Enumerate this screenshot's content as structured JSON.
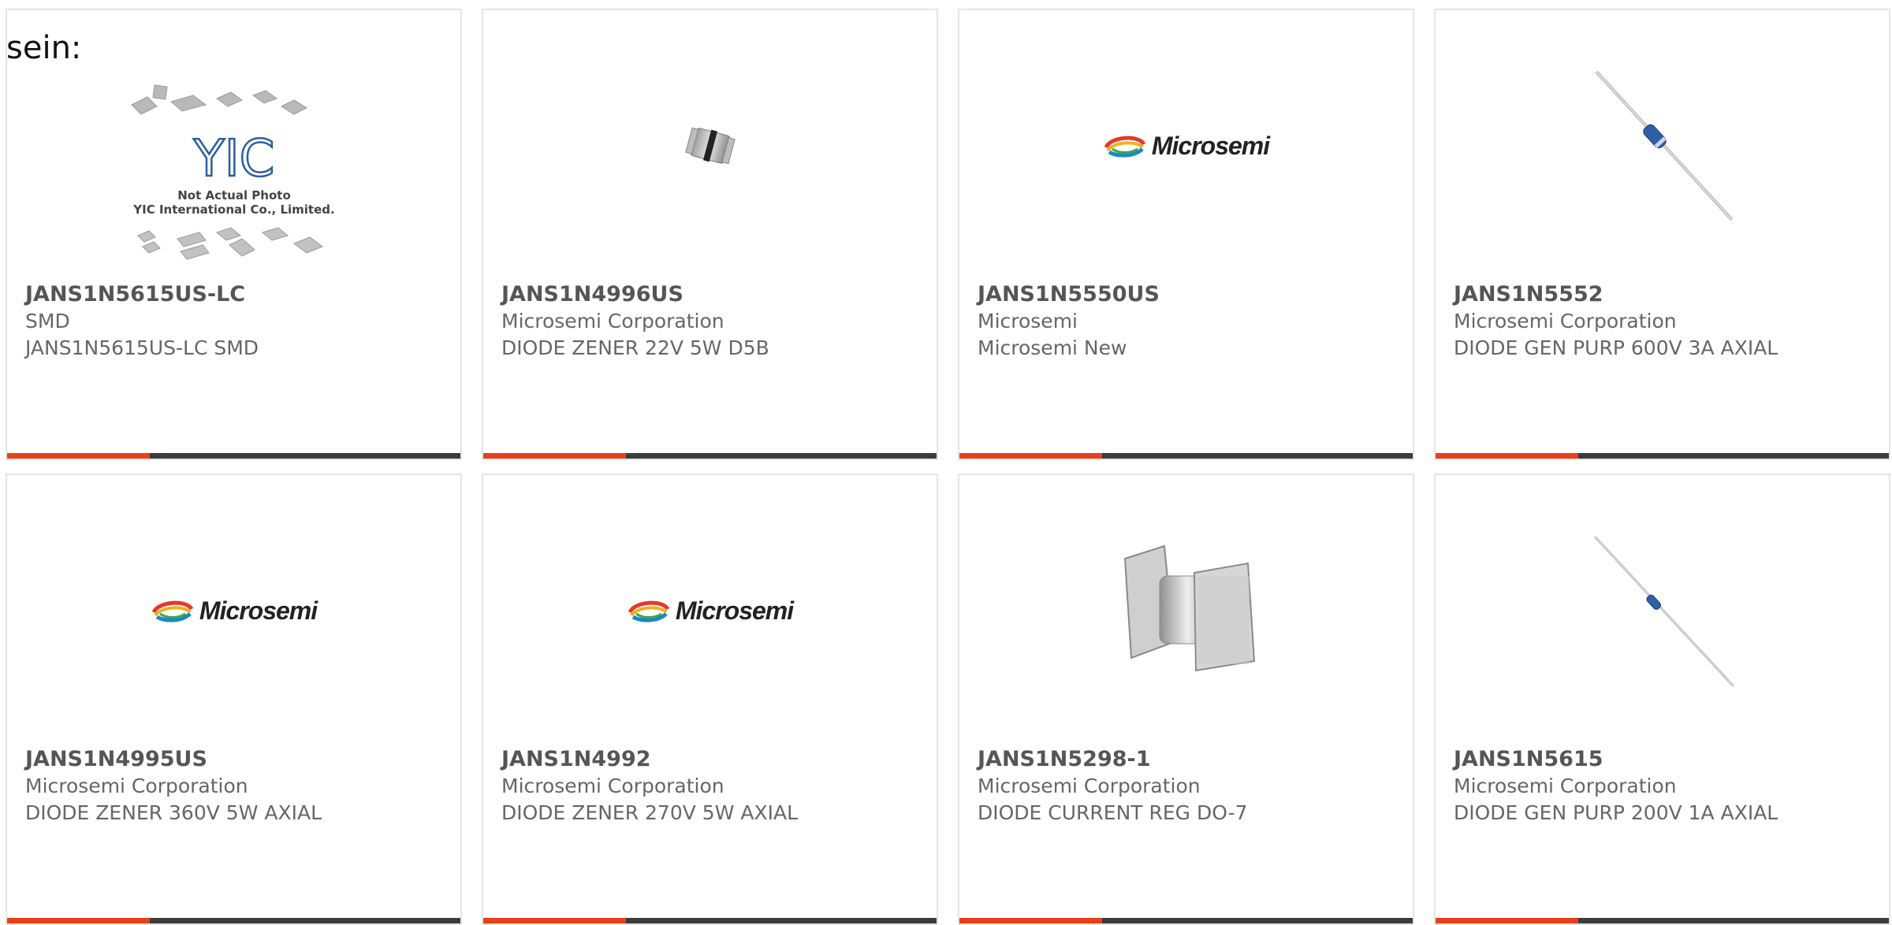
{
  "page_label": "sein:",
  "products": [
    {
      "part": "JANS1N5615US-LC",
      "manufacturer": "SMD",
      "description": "JANS1N5615US-LC SMD",
      "image": "not-actual-photo",
      "image_text": {
        "line1": "Not Actual Photo",
        "line2": "YIC International Co., Limited.",
        "logo": "YIC"
      }
    },
    {
      "part": "JANS1N4996US",
      "manufacturer": "Microsemi Corporation",
      "description": "DIODE ZENER 22V 5W D5B",
      "image": "smd-diode-photo"
    },
    {
      "part": "JANS1N5550US",
      "manufacturer": "Microsemi",
      "description": "Microsemi New",
      "image": "microsemi-logo",
      "logo_text": "Microsemi"
    },
    {
      "part": "JANS1N5552",
      "manufacturer": "Microsemi Corporation",
      "description": "DIODE GEN PURP 600V 3A AXIAL",
      "image": "axial-diode-photo"
    },
    {
      "part": "JANS1N4995US",
      "manufacturer": "Microsemi Corporation",
      "description": "DIODE ZENER 360V 5W AXIAL",
      "image": "microsemi-logo",
      "logo_text": "Microsemi"
    },
    {
      "part": "JANS1N4992",
      "manufacturer": "Microsemi Corporation",
      "description": "DIODE ZENER 270V 5W AXIAL",
      "image": "microsemi-logo",
      "logo_text": "Microsemi"
    },
    {
      "part": "JANS1N5298-1",
      "manufacturer": "Microsemi Corporation",
      "description": "DIODE CURRENT REG DO-7",
      "image": "square-package-photo"
    },
    {
      "part": "JANS1N5615",
      "manufacturer": "Microsemi Corporation",
      "description": "DIODE GEN PURP 200V 1A AXIAL",
      "image": "axial-diode-photo"
    }
  ],
  "colors": {
    "accent": "#e8401a",
    "bar": "#3c3c3c",
    "border": "#e4e4e4",
    "text": "#666666"
  }
}
